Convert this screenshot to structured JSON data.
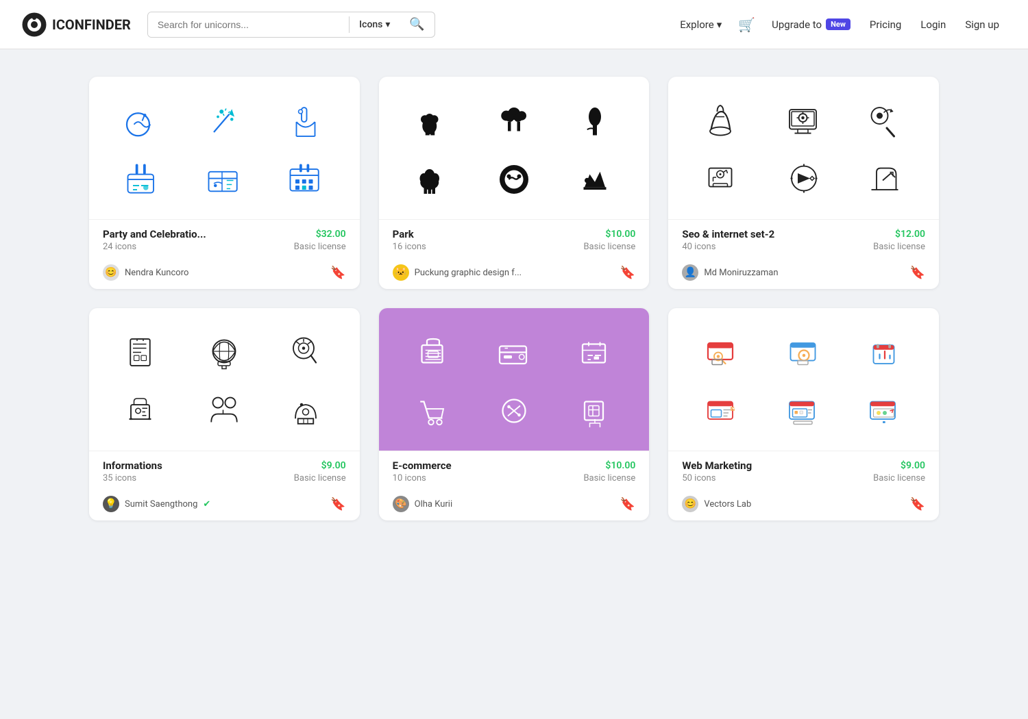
{
  "header": {
    "logo_text": "ICONFINDER",
    "search_placeholder": "Search for unicorns...",
    "search_dropdown_label": "Icons",
    "explore_label": "Explore",
    "upgrade_label": "Upgrade to",
    "new_badge": "New",
    "pricing_label": "Pricing",
    "login_label": "Login",
    "signup_label": "Sign up"
  },
  "cards": [
    {
      "id": "party",
      "title": "Party and Celebratio...",
      "icon_count": "24 icons",
      "price": "$32.00",
      "license": "Basic license",
      "author": "Nendra Kuncoro",
      "bg": "white",
      "verified": false
    },
    {
      "id": "park",
      "title": "Park",
      "icon_count": "16 icons",
      "price": "$10.00",
      "license": "Basic license",
      "author": "Puckung graphic design f...",
      "bg": "white",
      "verified": false
    },
    {
      "id": "seo",
      "title": "Seo & internet set-2",
      "icon_count": "40 icons",
      "price": "$12.00",
      "license": "Basic license",
      "author": "Md Moniruzzaman",
      "bg": "white",
      "verified": false
    },
    {
      "id": "informations",
      "title": "Informations",
      "icon_count": "35 icons",
      "price": "$9.00",
      "license": "Basic license",
      "author": "Sumit Saengthong",
      "bg": "white",
      "verified": true
    },
    {
      "id": "ecommerce",
      "title": "E-commerce",
      "icon_count": "10 icons",
      "price": "$10.00",
      "license": "Basic license",
      "author": "Olha Kurii",
      "bg": "purple",
      "verified": false
    },
    {
      "id": "webmarketing",
      "title": "Web Marketing",
      "icon_count": "50 icons",
      "price": "$9.00",
      "license": "Basic license",
      "author": "Vectors Lab",
      "bg": "white",
      "verified": false
    }
  ]
}
